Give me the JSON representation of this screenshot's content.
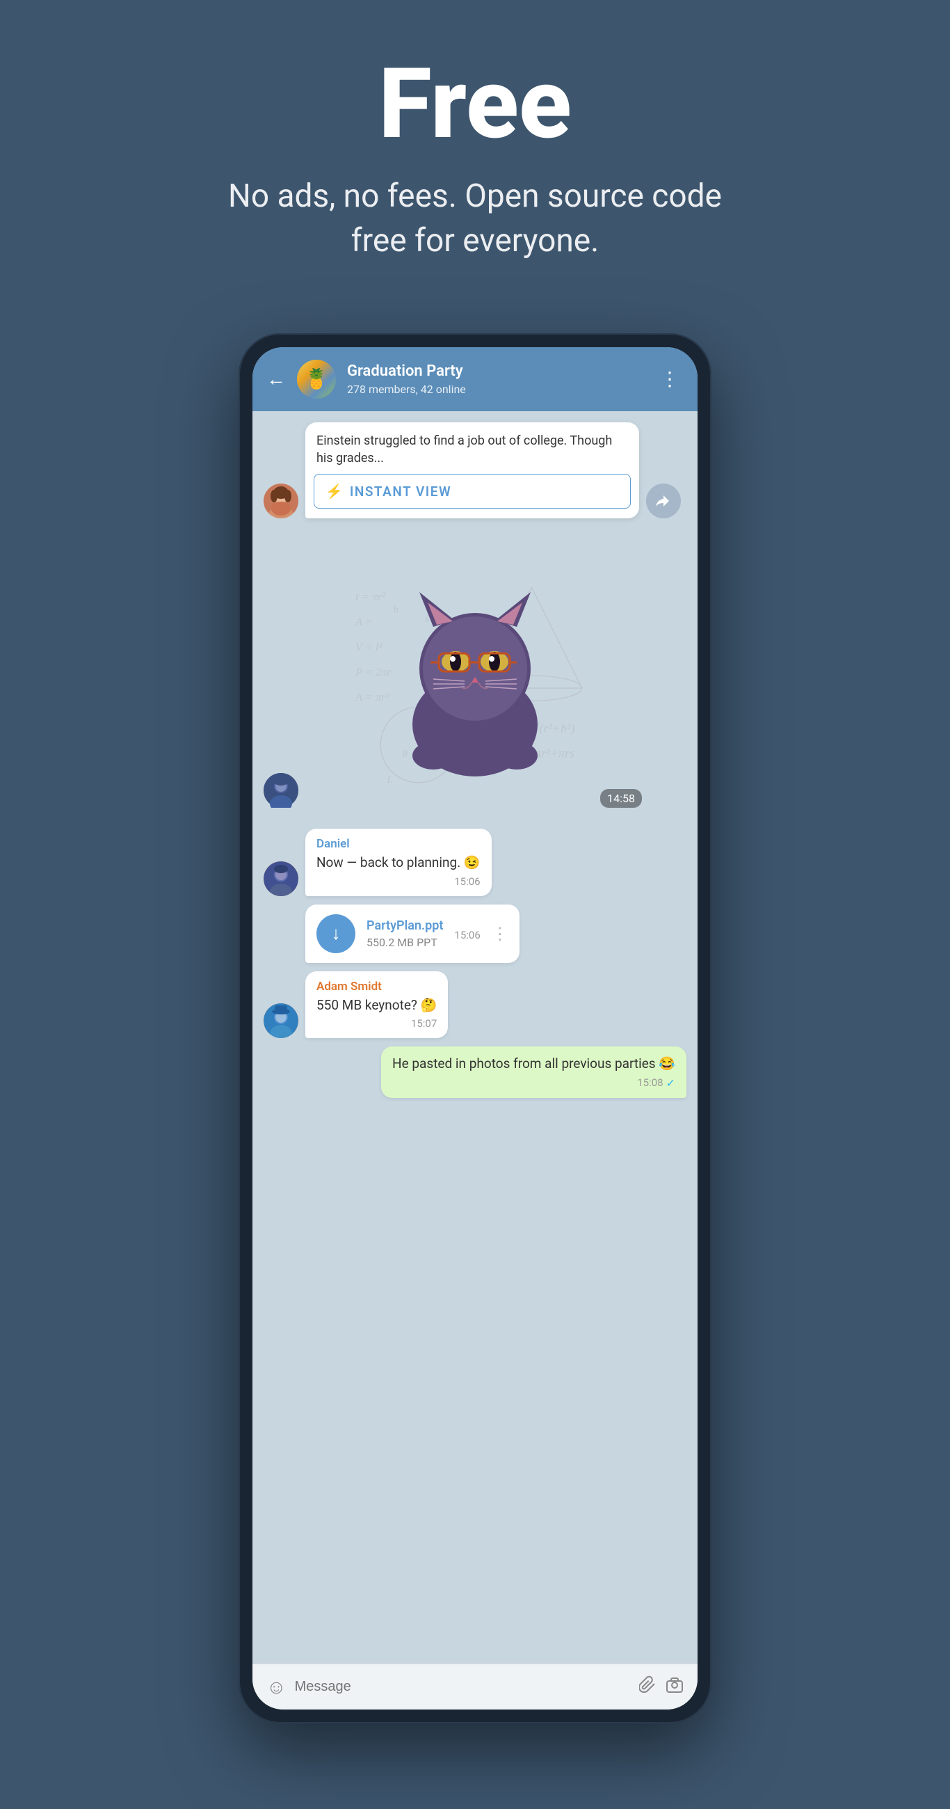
{
  "page": {
    "background_color": "#3d566e"
  },
  "hero": {
    "title": "Free",
    "subtitle": "No ads, no fees. Open source code free for everyone."
  },
  "chat": {
    "header": {
      "back_label": "←",
      "group_name": "Graduation Party",
      "group_status": "278 members, 42 online",
      "more_icon": "⋮"
    },
    "messages": [
      {
        "type": "article",
        "text": "Einstein struggled to find a job out of college. Though his grades...",
        "instant_view_label": "INSTANT VIEW"
      },
      {
        "type": "sticker",
        "time": "14:58"
      },
      {
        "type": "text",
        "sender": "Daniel",
        "text": "Now — back to planning. 😉",
        "time": "15:06"
      },
      {
        "type": "file",
        "file_name": "PartyPlan.ppt",
        "file_size": "550.2 MB PPT",
        "time": "15:06"
      },
      {
        "type": "text",
        "sender": "Adam Smidt",
        "text": "550 MB keynote? 🤔",
        "time": "15:07"
      },
      {
        "type": "own",
        "text": "He pasted in photos from all previous parties 😂",
        "time": "15:08",
        "read": true
      }
    ],
    "input": {
      "placeholder": "Message",
      "emoji_label": "☺",
      "attach_label": "📎",
      "camera_label": "⊙"
    }
  }
}
